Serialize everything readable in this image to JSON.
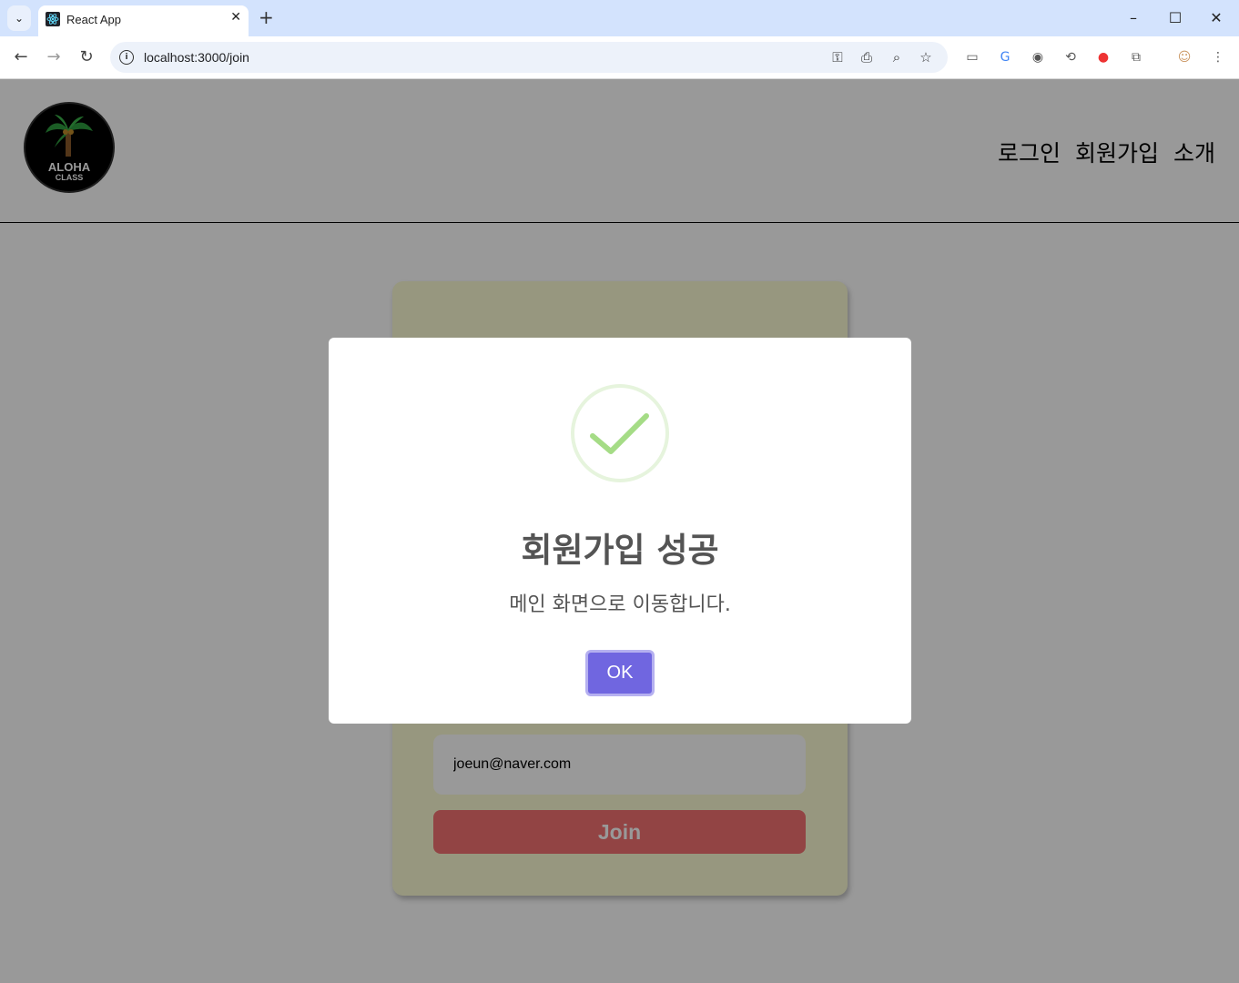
{
  "browser": {
    "tab_title": "React App",
    "url": "localhost:3000/join"
  },
  "site": {
    "logo_line1": "ALOHA",
    "logo_line2": "CLASS",
    "nav": [
      "로그인",
      "회원가입",
      "소개"
    ]
  },
  "form": {
    "email_value": "joeun@naver.com",
    "join_label": "Join"
  },
  "modal": {
    "title": "회원가입 성공",
    "message": "메인 화면으로 이동합니다.",
    "ok_label": "OK"
  },
  "colors": {
    "accent": "#7066e0",
    "join_button": "#f47272",
    "card_bg": "#fcfcd4",
    "success": "#a5dc86"
  }
}
